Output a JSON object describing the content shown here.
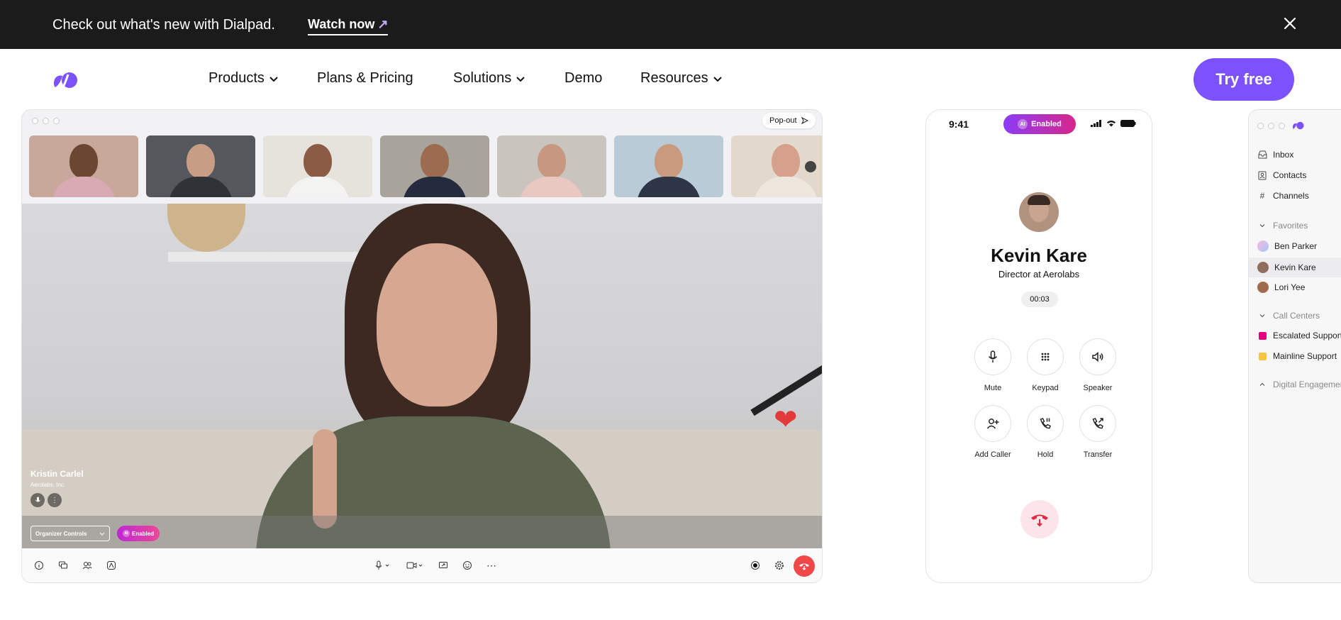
{
  "announcement": {
    "text": "Check out what's new with Dialpad.",
    "link_label": "Watch now",
    "link_arrow": "↗"
  },
  "nav": {
    "items": [
      {
        "label": "Products",
        "dropdown": true
      },
      {
        "label": "Plans & Pricing",
        "dropdown": false
      },
      {
        "label": "Solutions",
        "dropdown": true
      },
      {
        "label": "Demo",
        "dropdown": false
      },
      {
        "label": "Resources",
        "dropdown": true
      }
    ],
    "cta_label": "Try free"
  },
  "video_call": {
    "popout_label": "Pop-out",
    "speaker_name": "Kristin Carlel",
    "speaker_company": "Aerolabs, Inc.",
    "organizer_select_label": "Organizer Controls",
    "enabled_label": "Enabled",
    "reaction_icon": "heart-emoji"
  },
  "phone": {
    "time": "9:41",
    "enabled_label": "Enabled",
    "ai_mark": "AI",
    "caller_name": "Kevin Kare",
    "caller_title": "Director at Aerolabs",
    "timer": "00:03",
    "actions": [
      {
        "label": "Mute"
      },
      {
        "label": "Keypad"
      },
      {
        "label": "Speaker"
      },
      {
        "label": "Add Caller"
      },
      {
        "label": "Hold"
      },
      {
        "label": "Transfer"
      }
    ]
  },
  "sidebar": {
    "inbox": "Inbox",
    "contacts": "Contacts",
    "channels": "Channels",
    "favorites_header": "Favorites",
    "favorites": [
      "Ben Parker",
      "Kevin Kare",
      "Lori Yee"
    ],
    "call_centers_header": "Call Centers",
    "call_centers": [
      "Escalated Support",
      "Mainline Support"
    ],
    "digital_header": "Digital Engagement"
  },
  "colors": {
    "brand_purple": "#7c52ff",
    "announce_bg": "#1b1b1b",
    "enabled_gradient_start": "#8b3cf6",
    "enabled_gradient_end": "#d8268a",
    "end_call_red": "#f04848",
    "escalated_magenta": "#e6007e",
    "mainline_yellow": "#f5c542"
  }
}
